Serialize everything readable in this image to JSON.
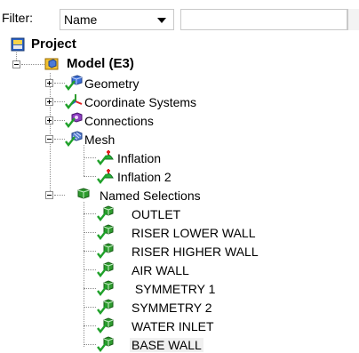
{
  "filter": {
    "label": "Filter:",
    "selected": "Name",
    "search_value": ""
  },
  "tree": {
    "root_label": "Project",
    "model_label": "Model (E3)",
    "geometry_label": "Geometry",
    "coordinate_systems_label": "Coordinate Systems",
    "connections_label": "Connections",
    "mesh_label": "Mesh",
    "inflation_1_label": "Inflation",
    "inflation_2_label": "Inflation 2",
    "named_selections_label": "Named Selections",
    "named_items": [
      "OUTLET",
      "RISER LOWER WALL",
      "RISER HIGHER WALL",
      "AIR WALL",
      " SYMMETRY 1",
      "SYMMETRY 2",
      "WATER INLET",
      "BASE WALL"
    ],
    "selected_item": "BASE WALL"
  },
  "colors": {
    "checkmark": "#1fa12a",
    "cube_blue": "#3d6fd6",
    "cube_purple": "#8d3fc0",
    "cube_green": "#2e9b2e",
    "inflation_green": "#27b23a",
    "inflation_red": "#e02020"
  }
}
